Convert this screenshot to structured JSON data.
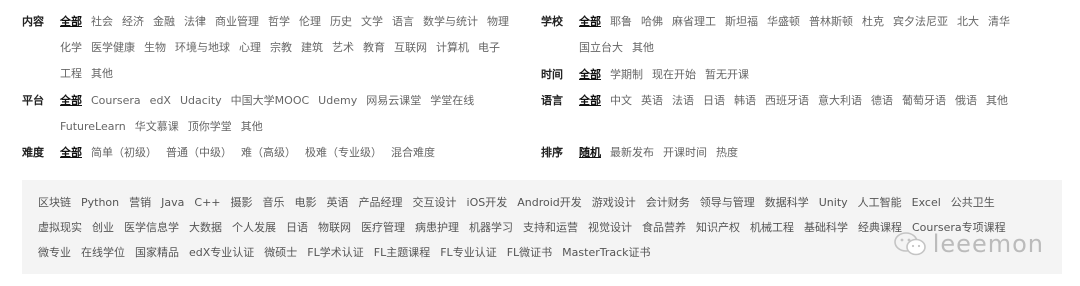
{
  "filters": {
    "content": {
      "label": "内容",
      "options": [
        "全部",
        "社会",
        "经济",
        "金融",
        "法律",
        "商业管理",
        "哲学",
        "伦理",
        "历史",
        "文学",
        "语言",
        "数学与统计",
        "物理",
        "化学",
        "医学健康",
        "生物",
        "环境与地球",
        "心理",
        "宗教",
        "建筑",
        "艺术",
        "教育",
        "互联网",
        "计算机",
        "电子",
        "工程",
        "其他"
      ]
    },
    "platform": {
      "label": "平台",
      "options": [
        "全部",
        "Coursera",
        "edX",
        "Udacity",
        "中国大学MOOC",
        "Udemy",
        "网易云课堂",
        "学堂在线",
        "FutureLearn",
        "华文慕课",
        "顶你学堂",
        "其他"
      ]
    },
    "difficulty": {
      "label": "难度",
      "options": [
        "全部",
        "简单（初级）",
        "普通（中级）",
        "难（高级）",
        "极难（专业级）",
        "混合难度"
      ]
    },
    "school": {
      "label": "学校",
      "options": [
        "全部",
        "耶鲁",
        "哈佛",
        "麻省理工",
        "斯坦福",
        "华盛顿",
        "普林斯顿",
        "杜克",
        "宾夕法尼亚",
        "北大",
        "清华",
        "国立台大",
        "其他"
      ]
    },
    "time": {
      "label": "时间",
      "options": [
        "全部",
        "学期制",
        "现在开始",
        "暂无开课"
      ]
    },
    "language": {
      "label": "语言",
      "options": [
        "全部",
        "中文",
        "英语",
        "法语",
        "日语",
        "韩语",
        "西班牙语",
        "意大利语",
        "德语",
        "葡萄牙语",
        "俄语",
        "其他"
      ]
    },
    "sort": {
      "label": "排序",
      "options": [
        "随机",
        "最新发布",
        "开课时间",
        "热度"
      ]
    }
  },
  "tags": [
    "区块链",
    "Python",
    "营销",
    "Java",
    "C++",
    "摄影",
    "音乐",
    "电影",
    "英语",
    "产品经理",
    "交互设计",
    "iOS开发",
    "Android开发",
    "游戏设计",
    "会计财务",
    "领导与管理",
    "数据科学",
    "Unity",
    "人工智能",
    "Excel",
    "公共卫生",
    "虚拟现实",
    "创业",
    "医学信息学",
    "大数据",
    "个人发展",
    "日语",
    "物联网",
    "医疗管理",
    "病患护理",
    "机器学习",
    "支持和运营",
    "视觉设计",
    "食品营养",
    "知识产权",
    "机械工程",
    "基础科学",
    "经典课程",
    "Coursera专项课程",
    "微专业",
    "在线学位",
    "国家精品",
    "edX专业认证",
    "微硕士",
    "FL学术认证",
    "FL主题课程",
    "FL专业认证",
    "FL微证书",
    "MasterTrack证书"
  ],
  "watermark": {
    "text": "leeemon",
    "icon": "wechat-icon"
  }
}
